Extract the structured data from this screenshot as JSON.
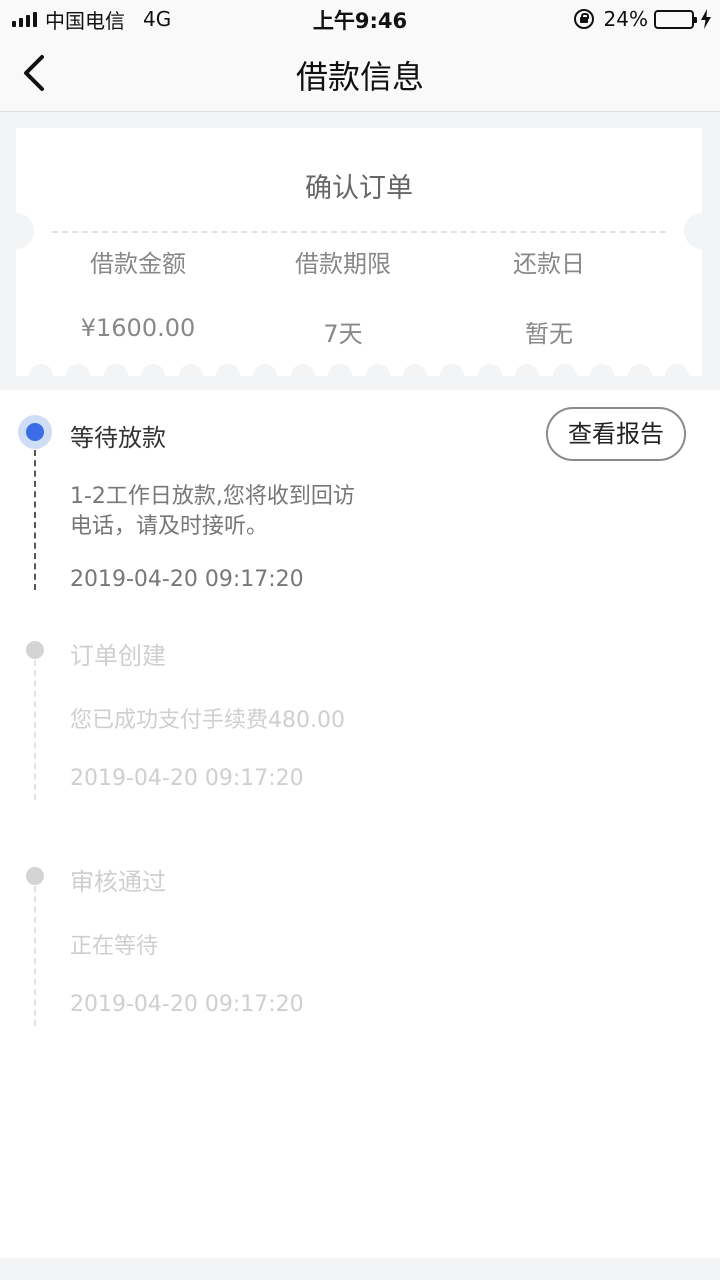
{
  "status_bar": {
    "carrier": "中国电信",
    "network": "4G",
    "time": "上午9:46",
    "battery_percent": "24%",
    "battery_level": 0.24
  },
  "nav": {
    "title": "借款信息",
    "back_icon": "chevron-left-icon"
  },
  "ticket": {
    "title": "确认订单",
    "columns": [
      {
        "label": "借款金额",
        "value": "¥1600.00"
      },
      {
        "label": "借款期限",
        "value": "7天"
      },
      {
        "label": "还款日",
        "value": "暂无"
      }
    ]
  },
  "timeline": {
    "report_button_label": "查看报告",
    "steps": [
      {
        "title": "等待放款",
        "desc_line1": "1-2工作日放款,您将收到回访",
        "desc_line2": "电话，请及时接听。",
        "time": "2019-04-20 09:17:20",
        "active": true
      },
      {
        "title": "订单创建",
        "desc_line1": "您已成功支付手续费480.00",
        "time": "2019-04-20 09:17:20",
        "active": false
      },
      {
        "title": "审核通过",
        "desc_line1": "正在等待",
        "time": "2019-04-20 09:17:20",
        "active": false
      }
    ]
  },
  "colors": {
    "accent": "#3a6ee8",
    "accent_halo": "#cfddf7",
    "inactive": "#d4d4d4",
    "page_bg": "#f3f4f6"
  }
}
